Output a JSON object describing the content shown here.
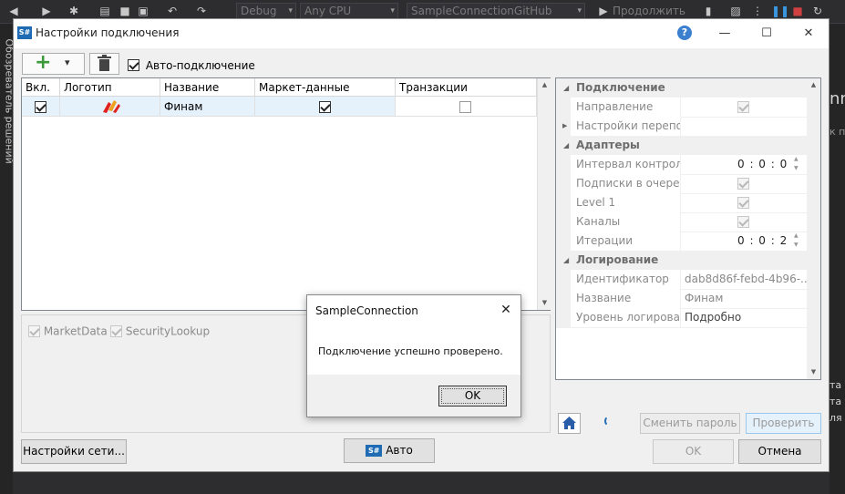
{
  "vs": {
    "config_combo": "Debug",
    "platform_combo": "Any CPU",
    "startup_combo": "SampleConnectionGitHub",
    "run_label": "Продолжить",
    "side_tab": "Обозреватель решений",
    "right_snippets": [
      "nn",
      "к па",
      "та т",
      "та т",
      "ля с"
    ]
  },
  "dialog": {
    "title": "Настройки подключения",
    "app_icon_text": "S#",
    "help_glyph": "?",
    "minimize_glyph": "—",
    "maximize_glyph": "☐",
    "close_glyph": "✕"
  },
  "toolbar": {
    "add_glyph": "+",
    "add_arrow": "▾",
    "delete_glyph": "🗑",
    "auto_connect_label": "Авто-подключение",
    "auto_connect_checked": true
  },
  "grid": {
    "columns": [
      "Вкл.",
      "Логотип",
      "Название",
      "Маркет-данные",
      "Транзакции"
    ],
    "rows": [
      {
        "enabled": true,
        "logo": "finam-logo",
        "name": "Финам",
        "market_data": true,
        "transactions": false
      }
    ]
  },
  "lower_panel": {
    "options": [
      {
        "label": "MarketData",
        "checked": true
      },
      {
        "label": "SecurityLookup",
        "checked": true
      }
    ]
  },
  "properties": {
    "categories": [
      {
        "name": "Подключение",
        "rows": [
          {
            "name": "Направление",
            "type": "check",
            "checked": true
          },
          {
            "name": "Настройки перепо",
            "type": "expand",
            "value": ""
          }
        ]
      },
      {
        "name": "Адаптеры",
        "rows": [
          {
            "name": "Интервал контроля",
            "type": "time",
            "value": "0 : 0 : 0"
          },
          {
            "name": "Подписки в очеред",
            "type": "check",
            "checked": true
          },
          {
            "name": "Level 1",
            "type": "check",
            "checked": true
          },
          {
            "name": "Каналы",
            "type": "check",
            "checked": true
          },
          {
            "name": "Итерации",
            "type": "time",
            "value": "0 : 0 : 2"
          }
        ]
      },
      {
        "name": "Логирование",
        "rows": [
          {
            "name": "Идентификатор",
            "type": "text",
            "value": "dab8d86f-febd-4b96-..."
          },
          {
            "name": "Название",
            "type": "text",
            "value": "Финам"
          },
          {
            "name": "Уровень логирова",
            "type": "text",
            "value": "Подробно",
            "dark": true
          }
        ]
      }
    ]
  },
  "prop_buttons": {
    "change_password": "Сменить пароль",
    "check": "Проверить"
  },
  "footer": {
    "network_settings": "Настройки сети...",
    "auto_icon": "S#",
    "auto": "Авто",
    "ok": "OK",
    "cancel": "Отмена"
  },
  "msgbox": {
    "title": "SampleConnection",
    "close_glyph": "✕",
    "message": "Подключение успешно проверено.",
    "ok": "OK"
  }
}
